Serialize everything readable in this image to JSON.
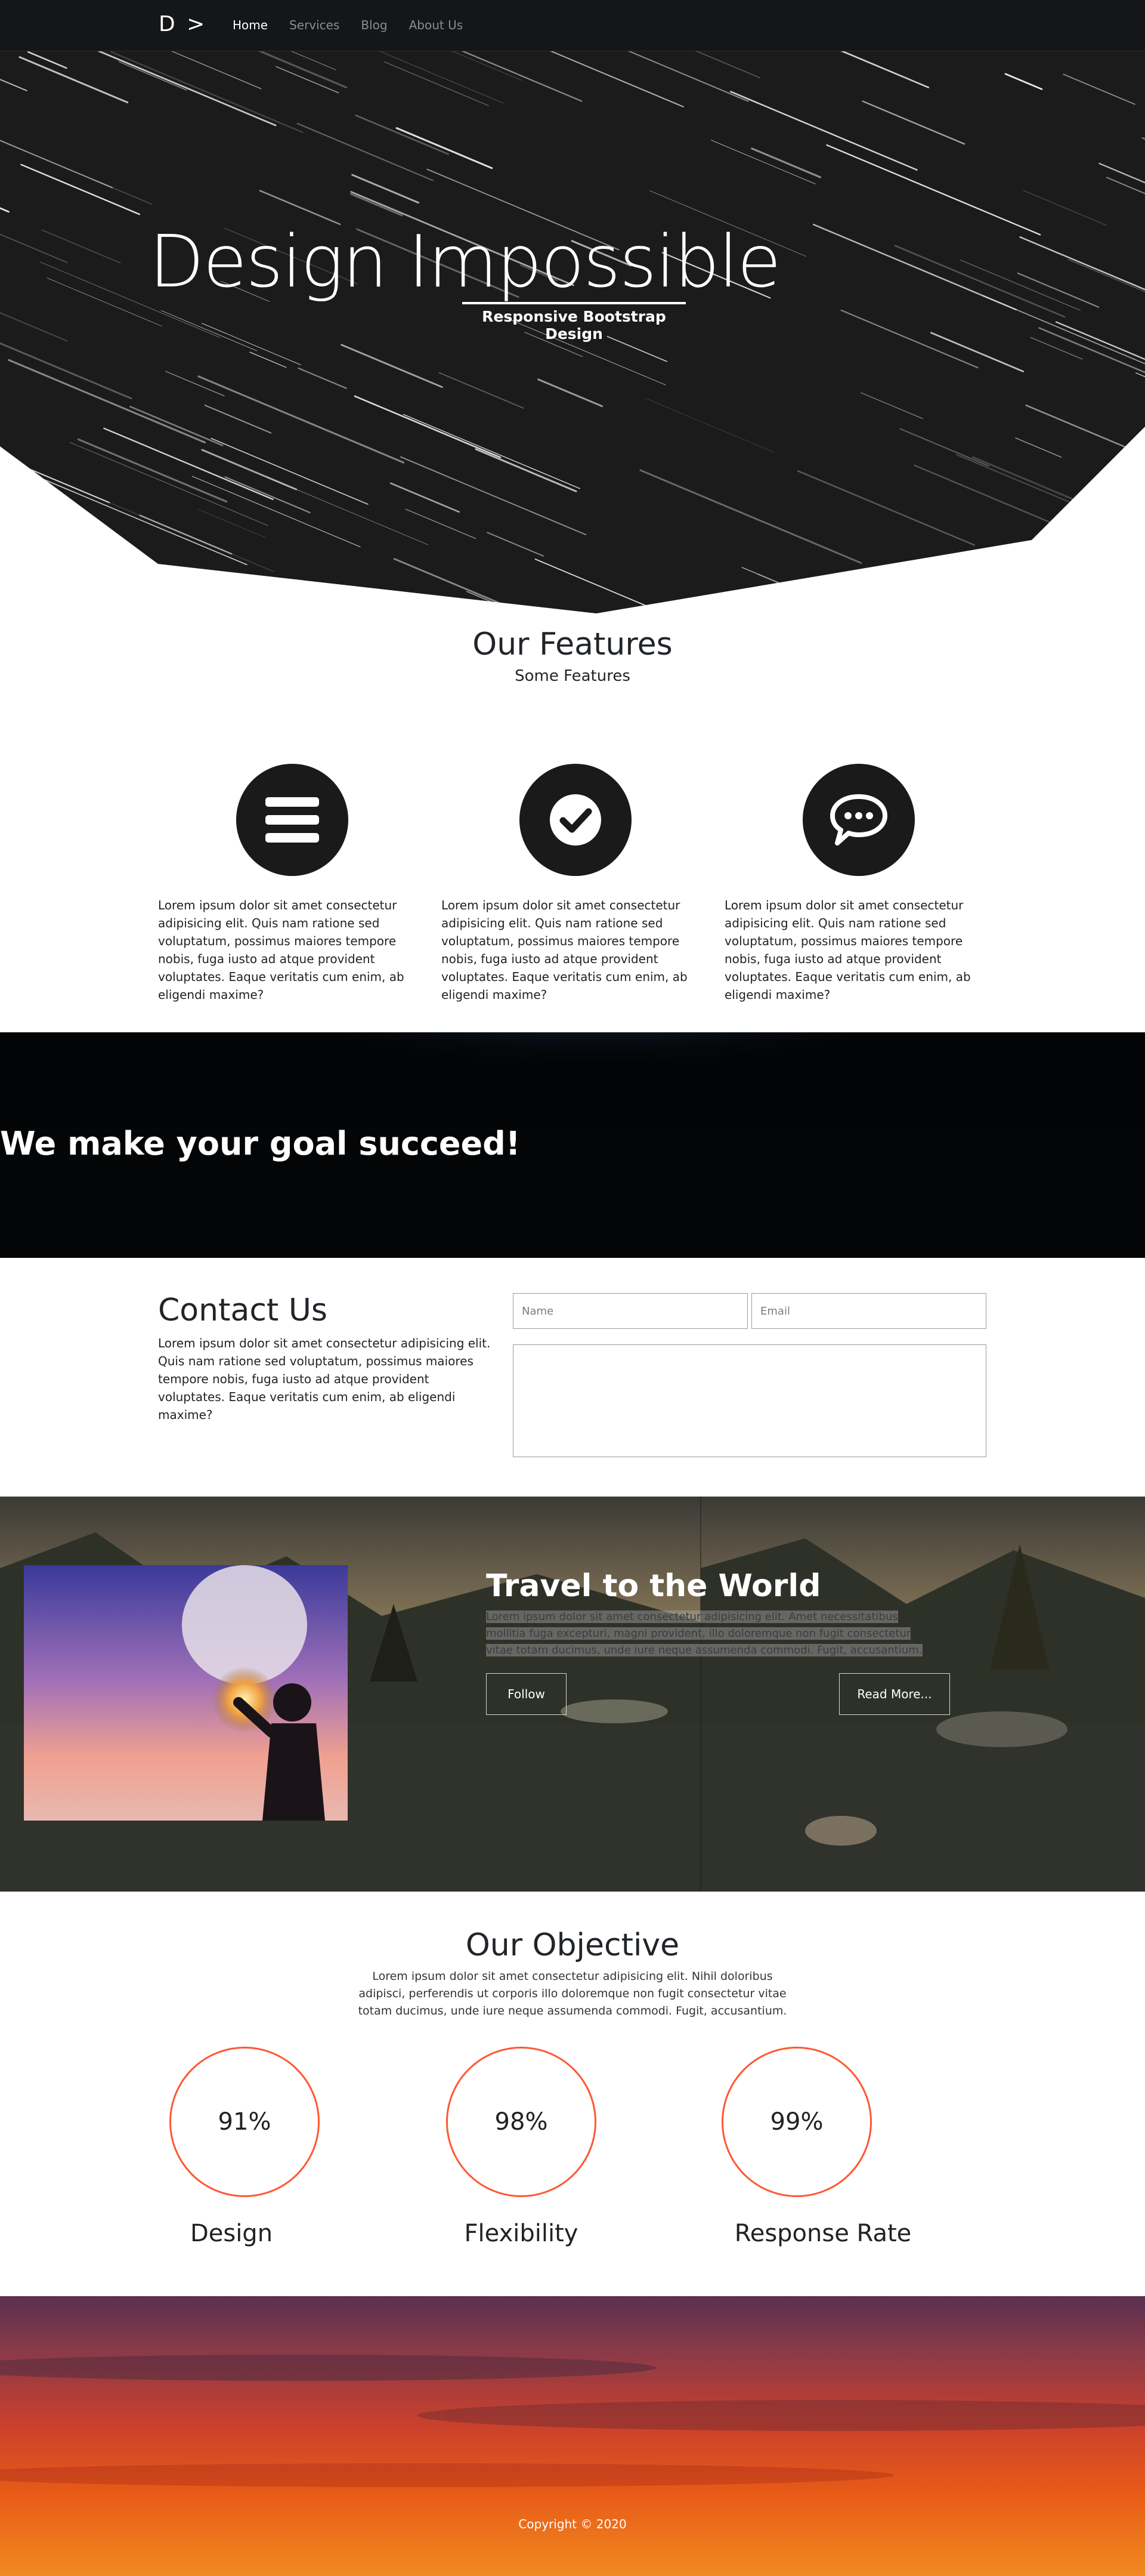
{
  "nav": {
    "brand": "D >",
    "links": [
      "Home",
      "Services",
      "Blog",
      "About Us"
    ]
  },
  "hero": {
    "title": "Design Impossible",
    "subtitle": "Responsive Bootstrap Design"
  },
  "features": {
    "title": "Our Features",
    "subtitle": "Some Features",
    "items": [
      {
        "icon": "menu-bars-icon",
        "text": "Lorem ipsum dolor sit amet consectetur adipisicing elit. Quis nam ratione sed voluptatum, possimus maiores tempore nobis, fuga iusto ad atque provident voluptates. Eaque veritatis cum enim, ab eligendi maxime?"
      },
      {
        "icon": "check-circle-icon",
        "text": "Lorem ipsum dolor sit amet consectetur adipisicing elit. Quis nam ratione sed voluptatum, possimus maiores tempore nobis, fuga iusto ad atque provident voluptates. Eaque veritatis cum enim, ab eligendi maxime?"
      },
      {
        "icon": "chat-bubble-icon",
        "text": "Lorem ipsum dolor sit amet consectetur adipisicing elit. Quis nam ratione sed voluptatum, possimus maiores tempore nobis, fuga iusto ad atque provident voluptates. Eaque veritatis cum enim, ab eligendi maxime?"
      }
    ]
  },
  "goal": {
    "title": "We make your goal succeed!"
  },
  "contact": {
    "title": "Contact Us",
    "text": "Lorem ipsum dolor sit amet consectetur adipisicing elit. Quis nam ratione sed voluptatum, possimus maiores tempore nobis, fuga iusto ad atque provident voluptates. Eaque veritatis cum enim, ab eligendi maxime?",
    "name_placeholder": "Name",
    "email_placeholder": "Email"
  },
  "travel": {
    "title": "Travel to the World",
    "text": "Lorem ipsum dolor sit amet consectetur adipisicing elit. Amet necessitatibus mollitia fuga excepturi, magni provident, illo doloremque non fugit consectetur vitae totam ducimus, unde iure neque assumenda commodi. Fugit, accusantium.",
    "follow_label": "Follow",
    "read_more_label": "Read More..."
  },
  "objective": {
    "title": "Our Objective",
    "text": "Lorem ipsum dolor sit amet consectetur adipisicing elit. Nihil doloribus adipisci, perferendis ut corporis illo doloremque non fugit consectetur vitae totam ducimus, unde iure neque assumenda commodi. Fugit, accusantium.",
    "stats": [
      {
        "value": "91%",
        "label": "Design"
      },
      {
        "value": "98%",
        "label": "Flexibility"
      },
      {
        "value": "99%",
        "label": "Response Rate"
      }
    ]
  },
  "footer": {
    "copyright": "Copyright © 2020"
  },
  "colors": {
    "accent_ring": "#ff5733",
    "dark": "#141617"
  }
}
